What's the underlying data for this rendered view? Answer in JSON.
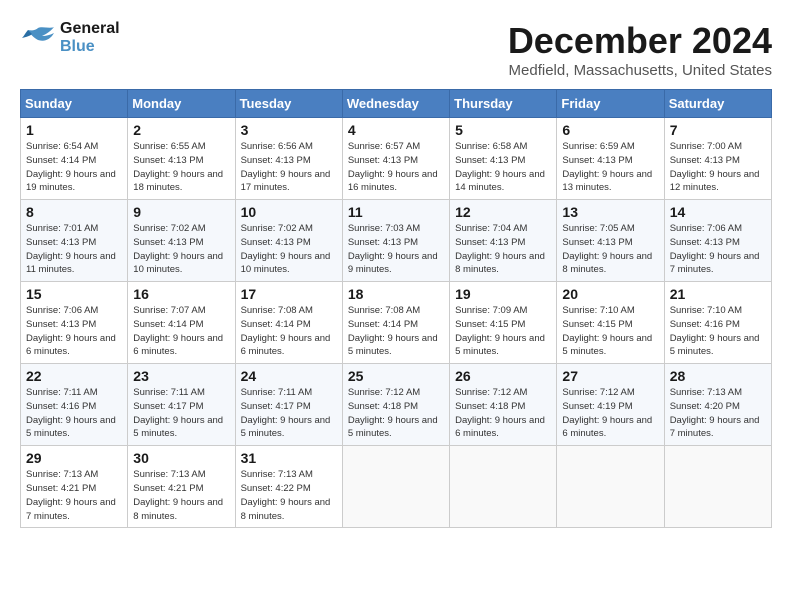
{
  "logo": {
    "text_general": "General",
    "text_blue": "Blue"
  },
  "header": {
    "title": "December 2024",
    "subtitle": "Medfield, Massachusetts, United States"
  },
  "weekdays": [
    "Sunday",
    "Monday",
    "Tuesday",
    "Wednesday",
    "Thursday",
    "Friday",
    "Saturday"
  ],
  "weeks": [
    [
      {
        "day": "1",
        "sunrise": "6:54 AM",
        "sunset": "4:14 PM",
        "daylight": "9 hours and 19 minutes."
      },
      {
        "day": "2",
        "sunrise": "6:55 AM",
        "sunset": "4:13 PM",
        "daylight": "9 hours and 18 minutes."
      },
      {
        "day": "3",
        "sunrise": "6:56 AM",
        "sunset": "4:13 PM",
        "daylight": "9 hours and 17 minutes."
      },
      {
        "day": "4",
        "sunrise": "6:57 AM",
        "sunset": "4:13 PM",
        "daylight": "9 hours and 16 minutes."
      },
      {
        "day": "5",
        "sunrise": "6:58 AM",
        "sunset": "4:13 PM",
        "daylight": "9 hours and 14 minutes."
      },
      {
        "day": "6",
        "sunrise": "6:59 AM",
        "sunset": "4:13 PM",
        "daylight": "9 hours and 13 minutes."
      },
      {
        "day": "7",
        "sunrise": "7:00 AM",
        "sunset": "4:13 PM",
        "daylight": "9 hours and 12 minutes."
      }
    ],
    [
      {
        "day": "8",
        "sunrise": "7:01 AM",
        "sunset": "4:13 PM",
        "daylight": "9 hours and 11 minutes."
      },
      {
        "day": "9",
        "sunrise": "7:02 AM",
        "sunset": "4:13 PM",
        "daylight": "9 hours and 10 minutes."
      },
      {
        "day": "10",
        "sunrise": "7:02 AM",
        "sunset": "4:13 PM",
        "daylight": "9 hours and 10 minutes."
      },
      {
        "day": "11",
        "sunrise": "7:03 AM",
        "sunset": "4:13 PM",
        "daylight": "9 hours and 9 minutes."
      },
      {
        "day": "12",
        "sunrise": "7:04 AM",
        "sunset": "4:13 PM",
        "daylight": "9 hours and 8 minutes."
      },
      {
        "day": "13",
        "sunrise": "7:05 AM",
        "sunset": "4:13 PM",
        "daylight": "9 hours and 8 minutes."
      },
      {
        "day": "14",
        "sunrise": "7:06 AM",
        "sunset": "4:13 PM",
        "daylight": "9 hours and 7 minutes."
      }
    ],
    [
      {
        "day": "15",
        "sunrise": "7:06 AM",
        "sunset": "4:13 PM",
        "daylight": "9 hours and 6 minutes."
      },
      {
        "day": "16",
        "sunrise": "7:07 AM",
        "sunset": "4:14 PM",
        "daylight": "9 hours and 6 minutes."
      },
      {
        "day": "17",
        "sunrise": "7:08 AM",
        "sunset": "4:14 PM",
        "daylight": "9 hours and 6 minutes."
      },
      {
        "day": "18",
        "sunrise": "7:08 AM",
        "sunset": "4:14 PM",
        "daylight": "9 hours and 5 minutes."
      },
      {
        "day": "19",
        "sunrise": "7:09 AM",
        "sunset": "4:15 PM",
        "daylight": "9 hours and 5 minutes."
      },
      {
        "day": "20",
        "sunrise": "7:10 AM",
        "sunset": "4:15 PM",
        "daylight": "9 hours and 5 minutes."
      },
      {
        "day": "21",
        "sunrise": "7:10 AM",
        "sunset": "4:16 PM",
        "daylight": "9 hours and 5 minutes."
      }
    ],
    [
      {
        "day": "22",
        "sunrise": "7:11 AM",
        "sunset": "4:16 PM",
        "daylight": "9 hours and 5 minutes."
      },
      {
        "day": "23",
        "sunrise": "7:11 AM",
        "sunset": "4:17 PM",
        "daylight": "9 hours and 5 minutes."
      },
      {
        "day": "24",
        "sunrise": "7:11 AM",
        "sunset": "4:17 PM",
        "daylight": "9 hours and 5 minutes."
      },
      {
        "day": "25",
        "sunrise": "7:12 AM",
        "sunset": "4:18 PM",
        "daylight": "9 hours and 5 minutes."
      },
      {
        "day": "26",
        "sunrise": "7:12 AM",
        "sunset": "4:18 PM",
        "daylight": "9 hours and 6 minutes."
      },
      {
        "day": "27",
        "sunrise": "7:12 AM",
        "sunset": "4:19 PM",
        "daylight": "9 hours and 6 minutes."
      },
      {
        "day": "28",
        "sunrise": "7:13 AM",
        "sunset": "4:20 PM",
        "daylight": "9 hours and 7 minutes."
      }
    ],
    [
      {
        "day": "29",
        "sunrise": "7:13 AM",
        "sunset": "4:21 PM",
        "daylight": "9 hours and 7 minutes."
      },
      {
        "day": "30",
        "sunrise": "7:13 AM",
        "sunset": "4:21 PM",
        "daylight": "9 hours and 8 minutes."
      },
      {
        "day": "31",
        "sunrise": "7:13 AM",
        "sunset": "4:22 PM",
        "daylight": "9 hours and 8 minutes."
      },
      null,
      null,
      null,
      null
    ]
  ]
}
